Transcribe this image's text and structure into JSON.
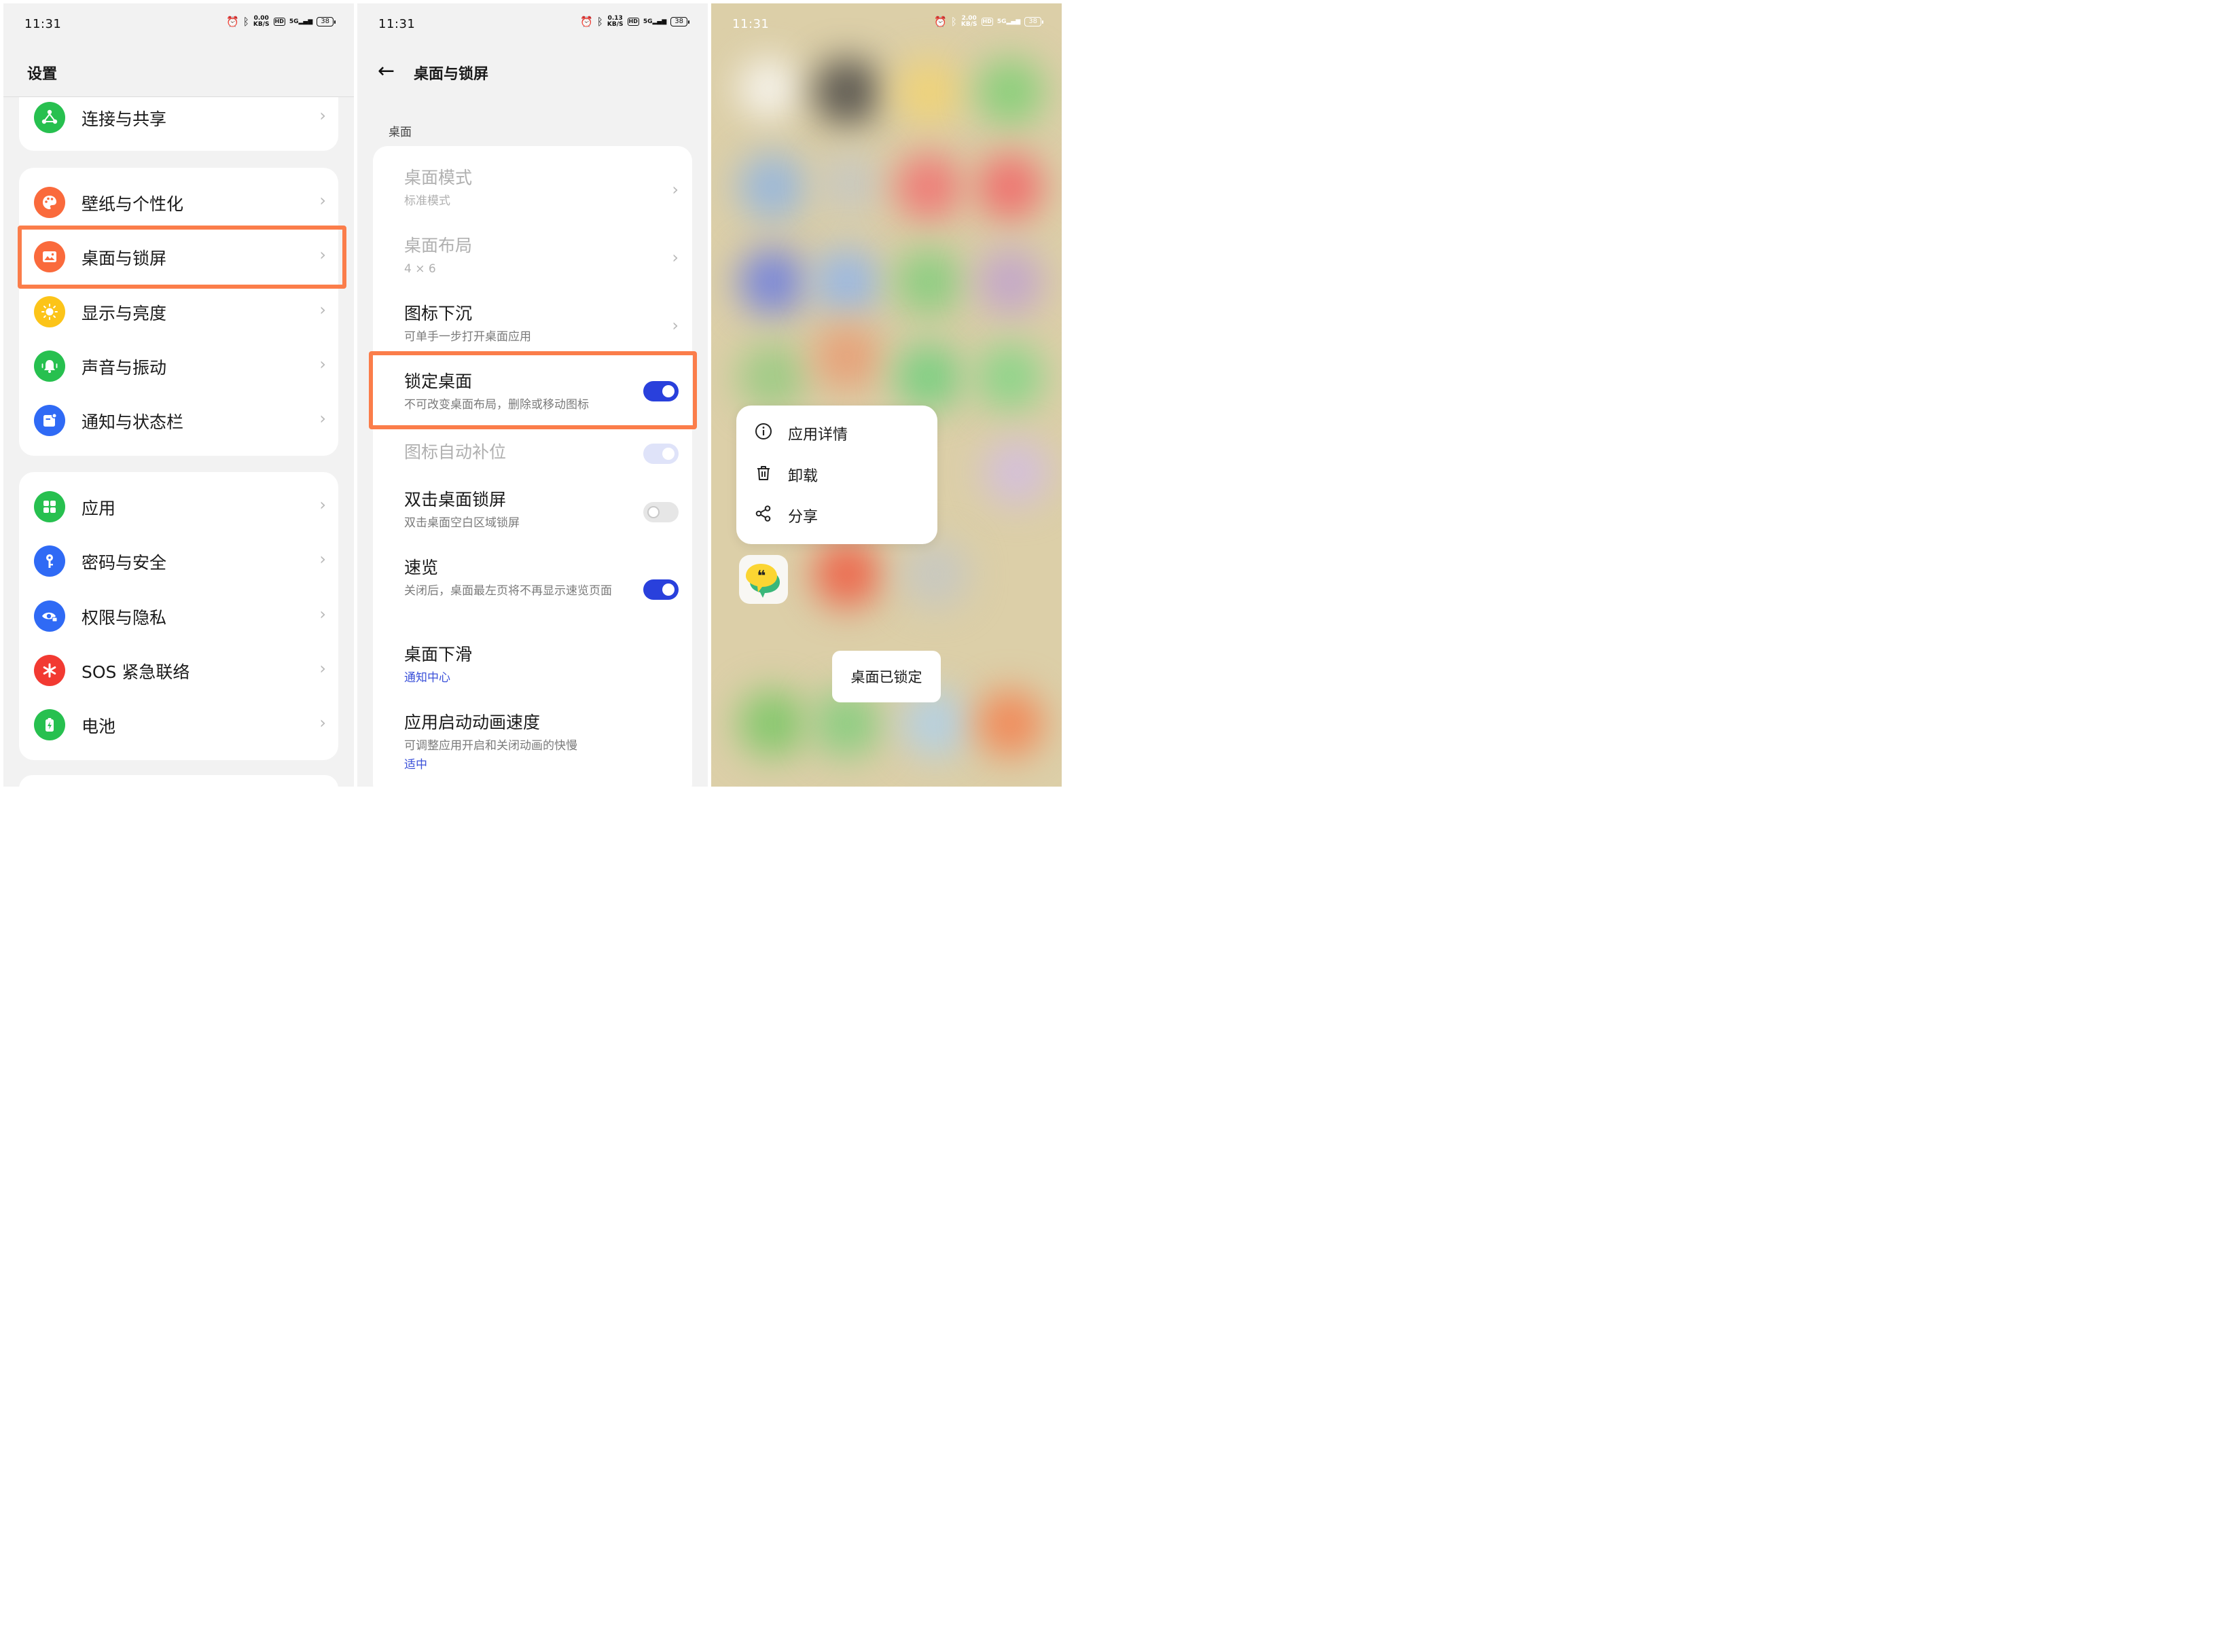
{
  "colors": {
    "accent": "#2940dc",
    "highlight": "#fb7d4a",
    "link": "#3a50d9"
  },
  "status_bar": {
    "left": {
      "time": "11:31",
      "speed_top": "0.00",
      "speed_unit": "KB/S",
      "hd": "HD",
      "net": "5G",
      "battery": "38"
    },
    "middle": {
      "time": "11:31",
      "speed_top": "0.13",
      "speed_unit": "KB/S",
      "hd": "HD",
      "net": "5G",
      "battery": "38"
    },
    "right": {
      "time": "11:31",
      "speed_top": "2.00",
      "speed_unit": "KB/S",
      "hd": "HD",
      "net": "5G",
      "battery": "38"
    }
  },
  "settings": {
    "title": "设置",
    "items": [
      {
        "label": "连接与共享",
        "icon": "share-icon",
        "color": "#27c04f"
      },
      {
        "label": "壁纸与个性化",
        "icon": "palette-icon",
        "color": "#fa6a3c"
      },
      {
        "label": "桌面与锁屏",
        "icon": "image-icon",
        "color": "#fa6a3c"
      },
      {
        "label": "显示与亮度",
        "icon": "sun-icon",
        "color": "#fcc419"
      },
      {
        "label": "声音与振动",
        "icon": "bell-icon",
        "color": "#27c04f"
      },
      {
        "label": "通知与状态栏",
        "icon": "notification-icon",
        "color": "#2f6af5"
      },
      {
        "label": "应用",
        "icon": "apps-icon",
        "color": "#27c04f"
      },
      {
        "label": "密码与安全",
        "icon": "key-icon",
        "color": "#2f6af5"
      },
      {
        "label": "权限与隐私",
        "icon": "privacy-eye-icon",
        "color": "#2f6af5"
      },
      {
        "label": "SOS 紧急联络",
        "icon": "sos-icon",
        "color": "#f23a32"
      },
      {
        "label": "电池",
        "icon": "battery-icon",
        "color": "#27c04f"
      }
    ],
    "chevron": "›"
  },
  "desktop_lock": {
    "back_glyph": "←",
    "title": "桌面与锁屏",
    "section": "桌面",
    "items": {
      "mode": {
        "title": "桌面模式",
        "sub": "标准模式"
      },
      "layout": {
        "title": "桌面布局",
        "sub": "4 × 6"
      },
      "sink": {
        "title": "图标下沉",
        "sub": "可单手一步打开桌面应用"
      },
      "lock": {
        "title": "锁定桌面",
        "sub": "不可改变桌面布局，删除或移动图标",
        "toggle": "on"
      },
      "autofill": {
        "title": "图标自动补位",
        "toggle": "on-disabled"
      },
      "doubletap": {
        "title": "双击桌面锁屏",
        "sub": "双击桌面空白区域锁屏",
        "toggle": "off"
      },
      "glance": {
        "title": "速览",
        "sub": "关闭后，桌面最左页将不再显示速览页面",
        "toggle": "on"
      },
      "swipe": {
        "title": "桌面下滑",
        "sub": "通知中心"
      },
      "anim": {
        "title": "应用启动动画速度",
        "sub": "可调整应用开启和关闭动画的快慢",
        "value": "适中"
      }
    }
  },
  "home": {
    "menu": [
      {
        "label": "应用详情",
        "icon": "info-icon"
      },
      {
        "label": "卸载",
        "icon": "trash-icon"
      },
      {
        "label": "分享",
        "icon": "share-nodes-icon"
      }
    ],
    "toast": "桌面已锁定"
  }
}
